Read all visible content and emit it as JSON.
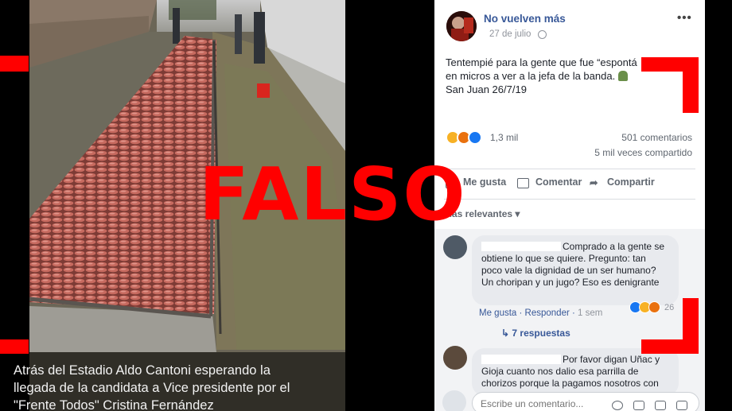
{
  "photo": {
    "caption": "Atrás del Estadio Aldo Cantoni esperando la llegada de la candidata a Vice presidente por el \"Frente Todos\" Cristina Fernández"
  },
  "post": {
    "page_name": "No vuelven más",
    "date": "27 de julio",
    "text_line1": "Tentempié para la gente que fue “espontá",
    "text_line2": "en micros a ver a la jefa de la banda. ",
    "text_line3": "San Juan 26/7/19",
    "reaction_count": "1,3 mil",
    "comments_count": "501 comentarios",
    "shares_count": "5 mil veces compartido",
    "actions": {
      "like": "Me gusta",
      "comment": "Comentar",
      "share": "Compartir"
    },
    "relevance": "Más relevantes ▾"
  },
  "comments": [
    {
      "text": "Comprado a la gente se obtiene lo que se quiere. Pregunto: tan poco vale la dignidad de un ser humano? Un choripan y un jugo? Eso es denigrante",
      "like": "Me gusta",
      "reply": "Responder",
      "time": "1 sem",
      "reaction_count": "26",
      "replies": "7 respuestas"
    },
    {
      "text": "Por favor digan Uñac y Gioja cuanto nos dalio esa parrilla de chorizos porque la pagamos nosotros con"
    }
  ],
  "composer": {
    "placeholder": "Escribe un comentario..."
  },
  "overlay": {
    "stamp": "FALSO",
    "color": "#ff0000"
  },
  "colors": {
    "link": "#385898",
    "like": "#1877f2",
    "stamp": "#ff0000"
  }
}
